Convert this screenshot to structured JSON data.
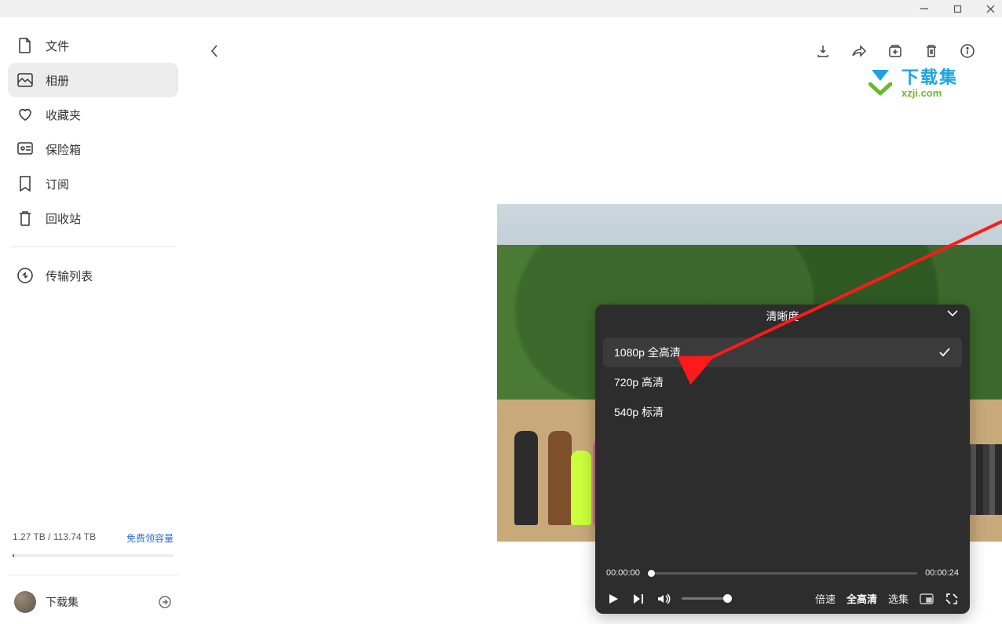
{
  "window": {
    "minimize": "—",
    "maximize": "▢",
    "close": "✕"
  },
  "sidebar": {
    "items": [
      {
        "label": "文件"
      },
      {
        "label": "相册"
      },
      {
        "label": "收藏夹"
      },
      {
        "label": "保险箱"
      },
      {
        "label": "订阅"
      },
      {
        "label": "回收站"
      }
    ],
    "transfer_label": "传输列表"
  },
  "storage": {
    "used": "1.27 TB",
    "sep": " / ",
    "total": "113.74 TB",
    "get_more": "免费领容量"
  },
  "user": {
    "name": "下载集"
  },
  "watermark": {
    "title": "下载集",
    "sub_a": "xzji",
    "sub_dot": ".",
    "sub_b": "com"
  },
  "quality_panel": {
    "title": "清晰度",
    "options": [
      {
        "label": "1080p 全高清",
        "selected": true
      },
      {
        "label": "720p 高清",
        "selected": false
      },
      {
        "label": "540p 标清",
        "selected": false
      }
    ]
  },
  "player": {
    "current_time": "00:00:00",
    "total_time": "00:00:24",
    "speed_label": "倍速",
    "quality_label": "全高清",
    "episodes_label": "选集"
  }
}
